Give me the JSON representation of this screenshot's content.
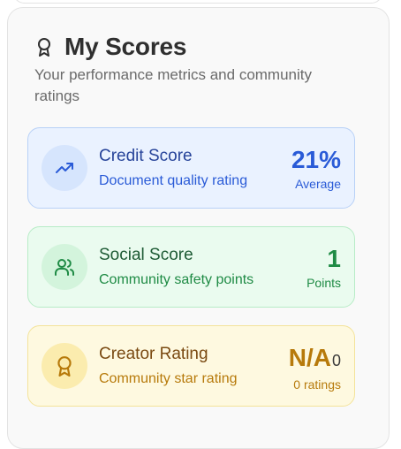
{
  "header": {
    "title": "My Scores",
    "subtitle": "Your performance metrics and community ratings",
    "icon": "award-ribbon-icon"
  },
  "scores": [
    {
      "name": "Credit Score",
      "description": "Document quality rating",
      "value": "21%",
      "unit": "Average",
      "icon": "trending-up-icon",
      "color": "#2a5bd7"
    },
    {
      "name": "Social Score",
      "description": "Community safety points",
      "value": "1",
      "unit": "Points",
      "icon": "users-icon",
      "color": "#1f8b45"
    },
    {
      "name": "Creator Rating",
      "description": "Community star rating",
      "value": "N/A",
      "value_suffix": "0",
      "unit": "0 ratings",
      "icon": "award-icon",
      "color": "#b77a0b"
    }
  ]
}
